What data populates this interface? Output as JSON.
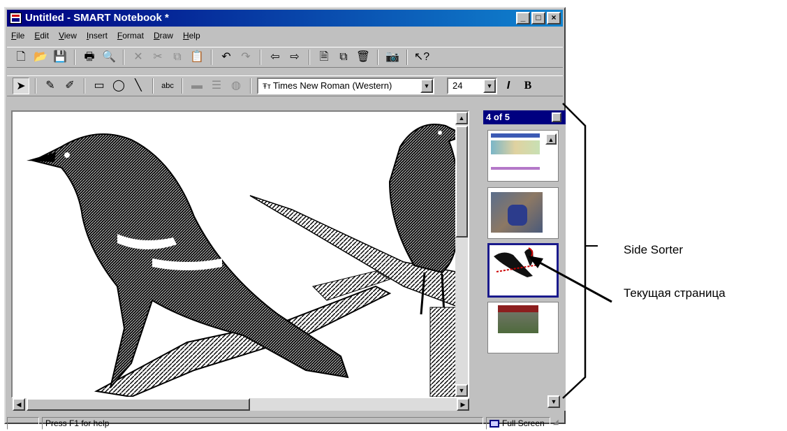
{
  "window": {
    "title": "Untitled - SMART Notebook *",
    "controls": {
      "minimize": "_",
      "maximize": "□",
      "close": "×"
    }
  },
  "menu": [
    "File",
    "Edit",
    "View",
    "Insert",
    "Format",
    "Draw",
    "Help"
  ],
  "toolbar": {
    "font_name": "Times New Roman (Western)",
    "font_size": "24",
    "italic": "I",
    "bold": "B",
    "text_tool": "abc"
  },
  "sorter": {
    "header": "4 of 5",
    "current_page": 3
  },
  "statusbar": {
    "help_text": "Press F1 for help",
    "fullscreen_label": "Full Screen"
  },
  "annotations": {
    "side_sorter": "Side Sorter",
    "current_page": "Текущая страница"
  },
  "colors": {
    "title_bar": "#000080",
    "window_face": "#c0c0c0",
    "current_page_border": "#1a1a8c"
  }
}
